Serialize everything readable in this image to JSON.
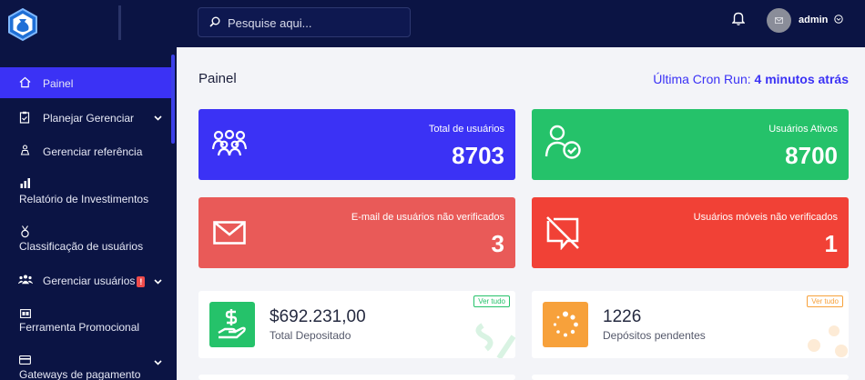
{
  "brand": {
    "logo_icon": "moneybag-hexagon-icon",
    "accent": "#3b32f5"
  },
  "sidebar": {
    "items": [
      {
        "label": "Painel",
        "icon": "home-icon",
        "active": true
      },
      {
        "label": "Planejar Gerenciar",
        "icon": "clipboard-icon",
        "has_submenu": true
      },
      {
        "label": "Gerenciar referência",
        "icon": "user-tree-icon"
      },
      {
        "label": "Relatório de Investimentos",
        "icon": "bar-chart-icon"
      },
      {
        "label": "Classificação de usuários",
        "icon": "medal-icon"
      },
      {
        "label": "Gerenciar usuários",
        "icon": "users-icon",
        "badge": "!",
        "has_submenu": true
      },
      {
        "label": "Ferramenta Promocional",
        "icon": "ad-icon"
      },
      {
        "label": "Gateways de pagamento",
        "icon": "credit-card-icon",
        "has_submenu": true
      }
    ]
  },
  "topbar": {
    "search_placeholder": "Pesquise aqui...",
    "username": "admin"
  },
  "page": {
    "title": "Painel",
    "cron_label": "Última Cron Run:",
    "cron_value": "4 minutos atrás"
  },
  "stats": [
    {
      "title": "Total de usuários",
      "value": "8703",
      "color": "#3b32f5",
      "icon": "users-group-icon"
    },
    {
      "title": "Usuários Ativos",
      "value": "8700",
      "color": "#25c26a",
      "icon": "user-check-icon"
    },
    {
      "title": "E-mail de usuários não verificados",
      "value": "3",
      "color": "#e95a58",
      "icon": "envelope-icon"
    },
    {
      "title": "Usuários móveis não verificados",
      "value": "1",
      "color": "#f14136",
      "icon": "mobile-off-icon"
    }
  ],
  "widgets": [
    {
      "amount": "$692.231,00",
      "label": "Total Depositado",
      "see_all": "Ver tudo",
      "color": "#25c26a",
      "icon": "hand-dollar-icon"
    },
    {
      "amount": "1226",
      "label": "Depósitos pendentes",
      "see_all": "Ver tudo",
      "color": "#f7a13b",
      "icon": "spinner-icon"
    }
  ]
}
